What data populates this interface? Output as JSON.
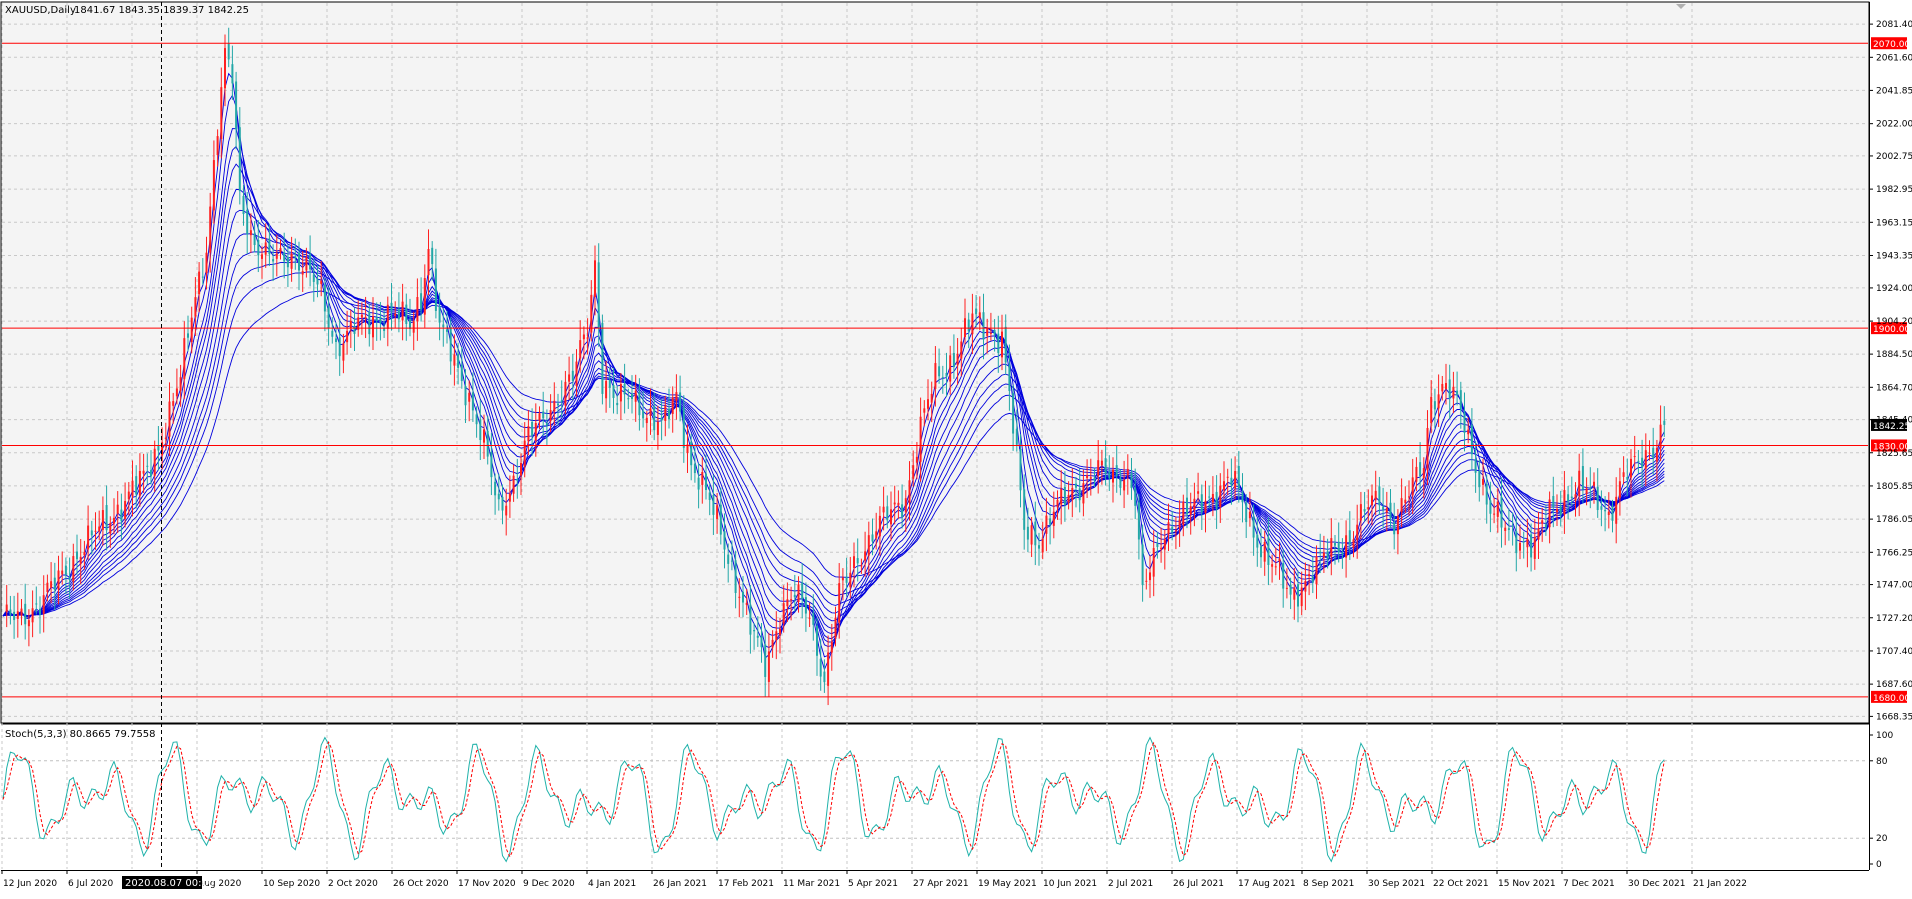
{
  "chart_data": [
    {
      "type": "line",
      "title": "XAUUSD,Daily",
      "ohlc_text": "1841.67 1843.35 1839.37 1842.25",
      "y_ticks": [
        2081.4,
        2061.6,
        2041.85,
        2022.0,
        2002.75,
        1982.95,
        1963.15,
        1943.35,
        1924.0,
        1904.2,
        1884.5,
        1864.7,
        1845.4,
        1825.65,
        1805.85,
        1786.05,
        1766.25,
        1747.0,
        1727.2,
        1707.4,
        1687.6,
        1668.35
      ],
      "ylim": [
        1665,
        2094
      ],
      "x_labels": [
        "12 Jun 2020",
        "6 Jul 2020",
        "",
        "Aug 2020",
        "10 Sep 2020",
        "2 Oct 2020",
        "26 Oct 2020",
        "17 Nov 2020",
        "9 Dec 2020",
        "4 Jan 2021",
        "26 Jan 2021",
        "17 Feb 2021",
        "11 Mar 2021",
        "5 Apr 2021",
        "27 Apr 2021",
        "19 May 2021",
        "10 Jun 2021",
        "2 Jul 2021",
        "26 Jul 2021",
        "17 Aug 2021",
        "8 Sep 2021",
        "30 Sep 2021",
        "22 Oct 2021",
        "15 Nov 2021",
        "7 Dec 2021",
        "30 Dec 2021",
        "21 Jan 2022"
      ],
      "crosshair_label": "2020.08.07 00:00",
      "horizontal_levels": [
        {
          "value": 2070.0,
          "label": "2070.00",
          "color": "#ff0000"
        },
        {
          "value": 1900.0,
          "label": "1900.00",
          "color": "#ff0000"
        },
        {
          "value": 1830.0,
          "label": "1830.00",
          "color": "#ff0000"
        },
        {
          "value": 1680.0,
          "label": "1680.00",
          "color": "#ff0000"
        }
      ],
      "current_price": {
        "value": 1842.25,
        "label": "1842.25"
      },
      "close_anchors": [
        [
          0,
          1725
        ],
        [
          10,
          1735
        ],
        [
          20,
          1765
        ],
        [
          30,
          1790
        ],
        [
          38,
          1810
        ],
        [
          42,
          1830
        ],
        [
          48,
          1870
        ],
        [
          52,
          1920
        ],
        [
          55,
          1950
        ],
        [
          58,
          2020
        ],
        [
          60,
          2060
        ],
        [
          62,
          2050
        ],
        [
          64,
          1980
        ],
        [
          68,
          1950
        ],
        [
          72,
          1940
        ],
        [
          78,
          1945
        ],
        [
          82,
          1935
        ],
        [
          86,
          1920
        ],
        [
          90,
          1890
        ],
        [
          95,
          1900
        ],
        [
          100,
          1905
        ],
        [
          105,
          1910
        ],
        [
          110,
          1900
        ],
        [
          113,
          1920
        ],
        [
          115,
          1950
        ],
        [
          118,
          1900
        ],
        [
          122,
          1880
        ],
        [
          126,
          1860
        ],
        [
          130,
          1830
        ],
        [
          134,
          1790
        ],
        [
          138,
          1810
        ],
        [
          142,
          1835
        ],
        [
          146,
          1845
        ],
        [
          150,
          1860
        ],
        [
          154,
          1870
        ],
        [
          158,
          1900
        ],
        [
          160,
          1940
        ],
        [
          162,
          1870
        ],
        [
          166,
          1855
        ],
        [
          170,
          1860
        ],
        [
          174,
          1850
        ],
        [
          178,
          1840
        ],
        [
          182,
          1860
        ],
        [
          186,
          1820
        ],
        [
          190,
          1800
        ],
        [
          194,
          1780
        ],
        [
          198,
          1750
        ],
        [
          202,
          1720
        ],
        [
          206,
          1700
        ],
        [
          210,
          1730
        ],
        [
          214,
          1740
        ],
        [
          218,
          1730
        ],
        [
          222,
          1690
        ],
        [
          226,
          1740
        ],
        [
          230,
          1760
        ],
        [
          236,
          1780
        ],
        [
          240,
          1790
        ],
        [
          244,
          1800
        ],
        [
          248,
          1840
        ],
        [
          252,
          1870
        ],
        [
          256,
          1880
        ],
        [
          262,
          1905
        ],
        [
          266,
          1900
        ],
        [
          270,
          1895
        ],
        [
          272,
          1860
        ],
        [
          276,
          1780
        ],
        [
          280,
          1775
        ],
        [
          284,
          1790
        ],
        [
          288,
          1800
        ],
        [
          292,
          1810
        ],
        [
          296,
          1815
        ],
        [
          300,
          1810
        ],
        [
          304,
          1815
        ],
        [
          306,
          1800
        ],
        [
          308,
          1740
        ],
        [
          310,
          1755
        ],
        [
          314,
          1780
        ],
        [
          320,
          1790
        ],
        [
          326,
          1800
        ],
        [
          332,
          1810
        ],
        [
          336,
          1790
        ],
        [
          340,
          1770
        ],
        [
          344,
          1755
        ],
        [
          348,
          1740
        ],
        [
          352,
          1750
        ],
        [
          356,
          1760
        ],
        [
          360,
          1770
        ],
        [
          364,
          1775
        ],
        [
          368,
          1790
        ],
        [
          372,
          1800
        ],
        [
          376,
          1785
        ],
        [
          380,
          1800
        ],
        [
          384,
          1820
        ],
        [
          386,
          1860
        ],
        [
          390,
          1865
        ],
        [
          394,
          1850
        ],
        [
          398,
          1820
        ],
        [
          402,
          1790
        ],
        [
          406,
          1780
        ],
        [
          410,
          1775
        ],
        [
          414,
          1770
        ],
        [
          418,
          1790
        ],
        [
          422,
          1800
        ],
        [
          426,
          1805
        ],
        [
          430,
          1800
        ],
        [
          434,
          1790
        ],
        [
          438,
          1810
        ],
        [
          442,
          1820
        ],
        [
          446,
          1830
        ],
        [
          449,
          1842.25
        ]
      ],
      "ma_periods": [
        3,
        5,
        8,
        10,
        12,
        15,
        18,
        22,
        26,
        30,
        35,
        45
      ],
      "ma_color": "#0000dd",
      "up_color": "#ff2020",
      "down_color": "#23a7a7",
      "plot_background": "#f4f4f4"
    },
    {
      "type": "line",
      "title": "Stoch(5,3,3) 80.8665 79.7558",
      "ylim": [
        0,
        100
      ],
      "y_ticks": [
        100,
        80,
        20,
        0
      ],
      "series": [
        {
          "values": [],
          "color": "#20b2aa",
          "style": "solid"
        },
        {
          "values": [],
          "color": "#ff0000",
          "style": "dashed"
        }
      ]
    }
  ]
}
